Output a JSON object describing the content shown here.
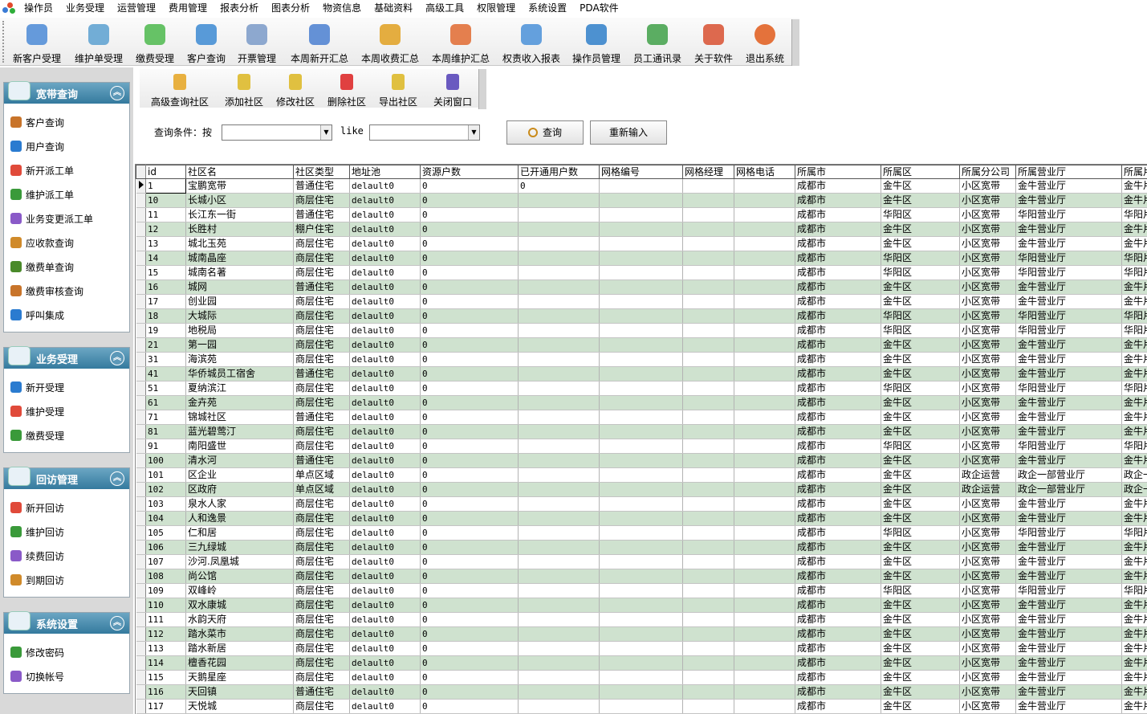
{
  "menu": [
    "操作员",
    "业务受理",
    "运营管理",
    "费用管理",
    "报表分析",
    "图表分析",
    "物资信息",
    "基础资料",
    "高级工具",
    "权限管理",
    "系统设置",
    "PDA软件"
  ],
  "toolbar": [
    "新客户受理",
    "维护单受理",
    "缴费受理",
    "客户查询",
    "开票管理",
    "本周新开汇总",
    "本周收费汇总",
    "本周维护汇总",
    "权责收入报表",
    "操作员管理",
    "员工通讯录",
    "关于软件",
    "退出系统"
  ],
  "panels": [
    {
      "title": "宽带查询",
      "items": [
        "客户查询",
        "用户查询",
        "新开派工单",
        "维护派工单",
        "业务变更派工单",
        "应收款查询",
        "缴费单查询",
        "缴费审核查询",
        "呼叫集成"
      ]
    },
    {
      "title": "业务受理",
      "items": [
        "新开受理",
        "维护受理",
        "缴费受理"
      ]
    },
    {
      "title": "回访管理",
      "items": [
        "新开回访",
        "维护回访",
        "续费回访",
        "到期回访"
      ]
    },
    {
      "title": "系统设置",
      "items": [
        "修改密码",
        "切换帐号"
      ]
    }
  ],
  "subtoolbar": [
    "高级查询社区",
    "添加社区",
    "修改社区",
    "删除社区",
    "导出社区",
    "关闭窗口"
  ],
  "query": {
    "label": "查询条件：按",
    "like": "like",
    "search": "查询",
    "reset": "重新输入"
  },
  "columns": [
    "id",
    "社区名",
    "社区类型",
    "地址池",
    "资源户数",
    "已开通用户数",
    "网格编号",
    "网格经理",
    "网格电话",
    "所属市",
    "所属区",
    "所属分公司",
    "所属营业厅",
    "所属片"
  ],
  "rows": [
    [
      "1",
      "宝鹏宽带",
      "普通住宅",
      "delault0",
      "0",
      "0",
      "",
      "",
      "",
      "成都市",
      "金牛区",
      "小区宽带",
      "金牛营业厅",
      "金牛片"
    ],
    [
      "10",
      "长城小区",
      "商层住宅",
      "delault0",
      "0",
      "",
      "",
      "",
      "",
      "成都市",
      "金牛区",
      "小区宽带",
      "金牛营业厅",
      "金牛片"
    ],
    [
      "11",
      "长江东一街",
      "普通住宅",
      "delault0",
      "0",
      "",
      "",
      "",
      "",
      "成都市",
      "华阳区",
      "小区宽带",
      "华阳营业厅",
      "华阳片"
    ],
    [
      "12",
      "长胜村",
      "棚户住宅",
      "delault0",
      "0",
      "",
      "",
      "",
      "",
      "成都市",
      "金牛区",
      "小区宽带",
      "金牛营业厅",
      "金牛片"
    ],
    [
      "13",
      "城北玉苑",
      "商层住宅",
      "delault0",
      "0",
      "",
      "",
      "",
      "",
      "成都市",
      "金牛区",
      "小区宽带",
      "金牛营业厅",
      "金牛片"
    ],
    [
      "14",
      "城南晶座",
      "商层住宅",
      "delault0",
      "0",
      "",
      "",
      "",
      "",
      "成都市",
      "华阳区",
      "小区宽带",
      "华阳营业厅",
      "华阳片"
    ],
    [
      "15",
      "城南名著",
      "商层住宅",
      "delault0",
      "0",
      "",
      "",
      "",
      "",
      "成都市",
      "华阳区",
      "小区宽带",
      "华阳营业厅",
      "华阳片"
    ],
    [
      "16",
      "城网",
      "普通住宅",
      "delault0",
      "0",
      "",
      "",
      "",
      "",
      "成都市",
      "金牛区",
      "小区宽带",
      "金牛营业厅",
      "金牛片"
    ],
    [
      "17",
      "创业园",
      "商层住宅",
      "delault0",
      "0",
      "",
      "",
      "",
      "",
      "成都市",
      "金牛区",
      "小区宽带",
      "金牛营业厅",
      "金牛片"
    ],
    [
      "18",
      "大城际",
      "商层住宅",
      "delault0",
      "0",
      "",
      "",
      "",
      "",
      "成都市",
      "华阳区",
      "小区宽带",
      "华阳营业厅",
      "华阳片"
    ],
    [
      "19",
      "地税局",
      "商层住宅",
      "delault0",
      "0",
      "",
      "",
      "",
      "",
      "成都市",
      "华阳区",
      "小区宽带",
      "华阳营业厅",
      "华阳片"
    ],
    [
      "21",
      "第一园",
      "商层住宅",
      "delault0",
      "0",
      "",
      "",
      "",
      "",
      "成都市",
      "金牛区",
      "小区宽带",
      "金牛营业厅",
      "金牛片"
    ],
    [
      "31",
      "海滨苑",
      "商层住宅",
      "delault0",
      "0",
      "",
      "",
      "",
      "",
      "成都市",
      "金牛区",
      "小区宽带",
      "金牛营业厅",
      "金牛片"
    ],
    [
      "41",
      "华侨城员工宿舍",
      "普通住宅",
      "delault0",
      "0",
      "",
      "",
      "",
      "",
      "成都市",
      "金牛区",
      "小区宽带",
      "金牛营业厅",
      "金牛片"
    ],
    [
      "51",
      "夏纳滨江",
      "商层住宅",
      "delault0",
      "0",
      "",
      "",
      "",
      "",
      "成都市",
      "华阳区",
      "小区宽带",
      "华阳营业厅",
      "华阳片"
    ],
    [
      "61",
      "金卉苑",
      "商层住宅",
      "delault0",
      "0",
      "",
      "",
      "",
      "",
      "成都市",
      "金牛区",
      "小区宽带",
      "金牛营业厅",
      "金牛片"
    ],
    [
      "71",
      "锦城社区",
      "普通住宅",
      "delault0",
      "0",
      "",
      "",
      "",
      "",
      "成都市",
      "金牛区",
      "小区宽带",
      "金牛营业厅",
      "金牛片"
    ],
    [
      "81",
      "蓝光碧莺汀",
      "商层住宅",
      "delault0",
      "0",
      "",
      "",
      "",
      "",
      "成都市",
      "金牛区",
      "小区宽带",
      "金牛营业厅",
      "金牛片"
    ],
    [
      "91",
      "南阳盛世",
      "商层住宅",
      "delault0",
      "0",
      "",
      "",
      "",
      "",
      "成都市",
      "华阳区",
      "小区宽带",
      "华阳营业厅",
      "华阳片"
    ],
    [
      "100",
      "清水河",
      "普通住宅",
      "delault0",
      "0",
      "",
      "",
      "",
      "",
      "成都市",
      "金牛区",
      "小区宽带",
      "金牛营业厅",
      "金牛片"
    ],
    [
      "101",
      "区企业",
      "单点区域",
      "delault0",
      "0",
      "",
      "",
      "",
      "",
      "成都市",
      "金牛区",
      "政企运营",
      "政企一部营业厅",
      "政企一部"
    ],
    [
      "102",
      "区政府",
      "单点区域",
      "delault0",
      "0",
      "",
      "",
      "",
      "",
      "成都市",
      "金牛区",
      "政企运营",
      "政企一部营业厅",
      "政企一部"
    ],
    [
      "103",
      "泉水人家",
      "商层住宅",
      "delault0",
      "0",
      "",
      "",
      "",
      "",
      "成都市",
      "金牛区",
      "小区宽带",
      "金牛营业厅",
      "金牛片"
    ],
    [
      "104",
      "人和逸景",
      "商层住宅",
      "delault0",
      "0",
      "",
      "",
      "",
      "",
      "成都市",
      "金牛区",
      "小区宽带",
      "金牛营业厅",
      "金牛片"
    ],
    [
      "105",
      "仁和居",
      "商层住宅",
      "delault0",
      "0",
      "",
      "",
      "",
      "",
      "成都市",
      "华阳区",
      "小区宽带",
      "华阳营业厅",
      "华阳片"
    ],
    [
      "106",
      "三九绿城",
      "商层住宅",
      "delault0",
      "0",
      "",
      "",
      "",
      "",
      "成都市",
      "金牛区",
      "小区宽带",
      "金牛营业厅",
      "金牛片"
    ],
    [
      "107",
      "沙河.凤凰城",
      "商层住宅",
      "delault0",
      "0",
      "",
      "",
      "",
      "",
      "成都市",
      "金牛区",
      "小区宽带",
      "金牛营业厅",
      "金牛片"
    ],
    [
      "108",
      "尚公馆",
      "商层住宅",
      "delault0",
      "0",
      "",
      "",
      "",
      "",
      "成都市",
      "金牛区",
      "小区宽带",
      "金牛营业厅",
      "金牛片"
    ],
    [
      "109",
      "双峰岭",
      "商层住宅",
      "delault0",
      "0",
      "",
      "",
      "",
      "",
      "成都市",
      "华阳区",
      "小区宽带",
      "华阳营业厅",
      "华阳片"
    ],
    [
      "110",
      "双水康城",
      "商层住宅",
      "delault0",
      "0",
      "",
      "",
      "",
      "",
      "成都市",
      "金牛区",
      "小区宽带",
      "金牛营业厅",
      "金牛片"
    ],
    [
      "111",
      "水韵天府",
      "商层住宅",
      "delault0",
      "0",
      "",
      "",
      "",
      "",
      "成都市",
      "金牛区",
      "小区宽带",
      "金牛营业厅",
      "金牛片"
    ],
    [
      "112",
      "踏水菜市",
      "商层住宅",
      "delault0",
      "0",
      "",
      "",
      "",
      "",
      "成都市",
      "金牛区",
      "小区宽带",
      "金牛营业厅",
      "金牛片"
    ],
    [
      "113",
      "踏水新居",
      "商层住宅",
      "delault0",
      "0",
      "",
      "",
      "",
      "",
      "成都市",
      "金牛区",
      "小区宽带",
      "金牛营业厅",
      "金牛片"
    ],
    [
      "114",
      "檀香花园",
      "商层住宅",
      "delault0",
      "0",
      "",
      "",
      "",
      "",
      "成都市",
      "金牛区",
      "小区宽带",
      "金牛营业厅",
      "金牛片"
    ],
    [
      "115",
      "天鹅星座",
      "商层住宅",
      "delault0",
      "0",
      "",
      "",
      "",
      "",
      "成都市",
      "金牛区",
      "小区宽带",
      "金牛营业厅",
      "金牛片"
    ],
    [
      "116",
      "天回镇",
      "普通住宅",
      "delault0",
      "0",
      "",
      "",
      "",
      "",
      "成都市",
      "金牛区",
      "小区宽带",
      "金牛营业厅",
      "金牛片"
    ],
    [
      "117",
      "天悦城",
      "商层住宅",
      "delault0",
      "0",
      "",
      "",
      "",
      "",
      "成都市",
      "金牛区",
      "小区宽带",
      "金牛营业厅",
      "金牛片"
    ]
  ],
  "colors": {
    "header_accent": "#347a9e",
    "row_alt": "#cfe2cf"
  }
}
